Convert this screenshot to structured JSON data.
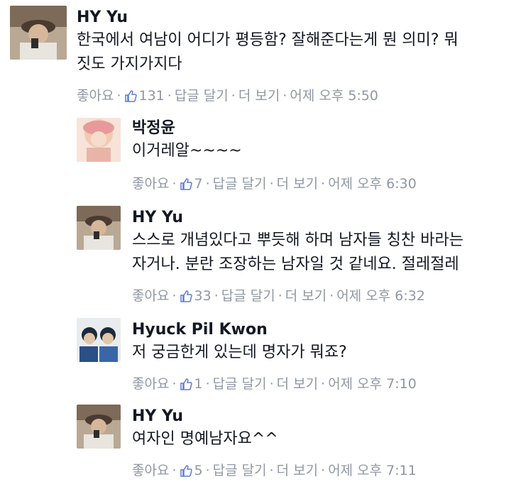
{
  "comments": [
    {
      "author": "HY Yu",
      "lines": [
        "한국에서 여남이 어디가 평등함? 잘해준다는게 뭔 의미? 뭐",
        "짓도 가지가지다"
      ],
      "like_label": "좋아요",
      "like_count": "131",
      "reply_label": "답글 달기",
      "more_label": "더 보기",
      "time": "어제 오후 5:50",
      "avatar_colors": [
        "#5c4a3e",
        "#c9b8a4"
      ]
    },
    {
      "author": "박정윤",
      "lines": [
        "이거레알~~~~"
      ],
      "like_label": "좋아요",
      "like_count": "7",
      "reply_label": "답글 달기",
      "more_label": "더 보기",
      "time": "어제 오후 6:30",
      "avatar_colors": [
        "#f2c9b4",
        "#e79a9a"
      ]
    },
    {
      "author": "HY Yu",
      "lines": [
        "스스로 개념있다고 뿌듯해 하며 남자들 칭찬 바라는",
        "자거나. 분란 조장하는 남자일 것 같네요. 절레절레"
      ],
      "like_label": "좋아요",
      "like_count": "33",
      "reply_label": "답글 달기",
      "more_label": "더 보기",
      "time": "어제 오후 6:32",
      "avatar_colors": [
        "#5c4a3e",
        "#c9b8a4"
      ]
    },
    {
      "author": "Hyuck Pil Kwon",
      "lines": [
        "저 궁금한게 있는데 명자가 뭐죠?"
      ],
      "like_label": "좋아요",
      "like_count": "1",
      "reply_label": "답글 달기",
      "more_label": "더 보기",
      "time": "어제 오후 7:10",
      "avatar_colors": [
        "#2b4f86",
        "#e9ecef"
      ]
    },
    {
      "author": "HY Yu",
      "lines": [
        "여자인 명예남자요^^"
      ],
      "like_label": "좋아요",
      "like_count": "5",
      "reply_label": "답글 달기",
      "more_label": "더 보기",
      "time": "어제 오후 7:11",
      "avatar_colors": [
        "#5c4a3e",
        "#c9b8a4"
      ]
    }
  ],
  "colors": {
    "text": "#141823",
    "meta": "#9197a3",
    "like_icon": "#5b7bd5"
  }
}
